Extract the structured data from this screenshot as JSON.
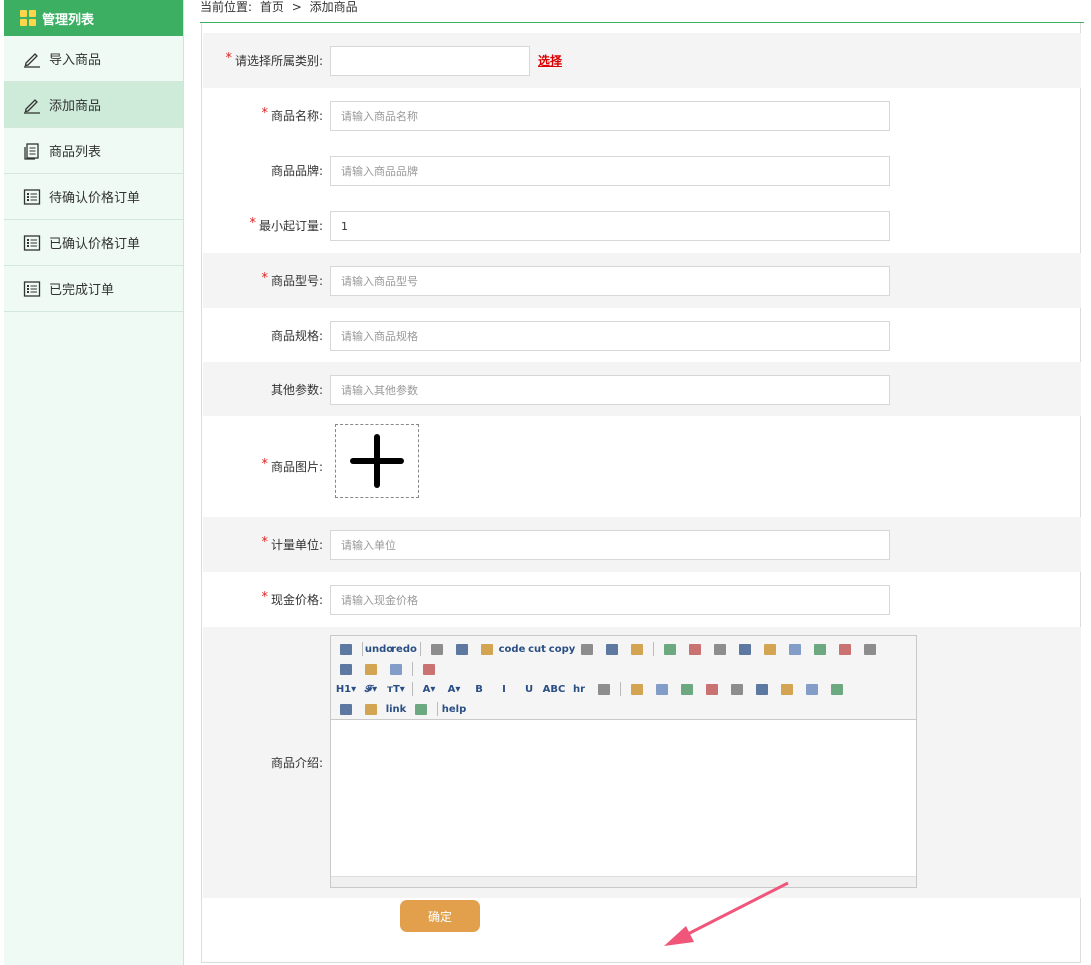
{
  "sidebar": {
    "title": "管理列表",
    "items": [
      {
        "label": "导入商品",
        "icon": "pencil-icon"
      },
      {
        "label": "添加商品",
        "icon": "pencil-icon",
        "active": true
      },
      {
        "label": "商品列表",
        "icon": "document-icon"
      },
      {
        "label": "待确认价格订单",
        "icon": "list-icon"
      },
      {
        "label": "已确认价格订单",
        "icon": "list-icon"
      },
      {
        "label": "已完成订单",
        "icon": "list-icon"
      }
    ]
  },
  "breadcrumb": {
    "prefix": "当前位置:",
    "home": "首页",
    "separator": ">",
    "current": "添加商品"
  },
  "form": {
    "category": {
      "label": "请选择所属类别:",
      "value": "",
      "select_link": "选择",
      "required": true
    },
    "name": {
      "label": "商品名称:",
      "placeholder": "请输入商品名称",
      "required": true
    },
    "brand": {
      "label": "商品品牌:",
      "placeholder": "请输入商品品牌",
      "required": false
    },
    "min_order": {
      "label": "最小起订量:",
      "value": "1",
      "required": true
    },
    "model": {
      "label": "商品型号:",
      "placeholder": "请输入商品型号",
      "required": true
    },
    "spec": {
      "label": "商品规格:",
      "placeholder": "请输入商品规格",
      "required": false
    },
    "params": {
      "label": "其他参数:",
      "placeholder": "请输入其他参数",
      "required": false
    },
    "image": {
      "label": "商品图片:",
      "required": true
    },
    "unit": {
      "label": "计量单位:",
      "placeholder": "请输入单位",
      "required": true
    },
    "price": {
      "label": "现金价格:",
      "placeholder": "请输入现金价格",
      "required": true
    },
    "intro": {
      "label": "商品介绍:",
      "required": false
    },
    "submit_label": "确定"
  },
  "editor_toolbar": {
    "row1": [
      "source",
      "|",
      "undo",
      "redo",
      "|",
      "preview",
      "print",
      "template",
      "code",
      "cut",
      "copy",
      "paste",
      "paste-plain",
      "paste-word",
      "|",
      "align-left",
      "align-center",
      "align-right",
      "align-justify",
      "ordered-list",
      "unordered-list",
      "indent",
      "outdent",
      "subscript"
    ],
    "row2": [
      "superscript",
      "clear-format",
      "select-all",
      "|",
      "fullscreen"
    ],
    "row3": [
      "H1▾",
      "𝓕▾",
      "тT▾",
      "|",
      "A▾",
      "A▾",
      "B",
      "I",
      "U",
      "ABC",
      "hr",
      "eraser",
      "|",
      "image",
      "multi-image",
      "flash",
      "media",
      "attachment",
      "table",
      "insert-hr",
      "emoticon",
      "picture"
    ],
    "row4": [
      "pagebreak",
      "anchor",
      "link",
      "unlink",
      "|",
      "help"
    ]
  }
}
